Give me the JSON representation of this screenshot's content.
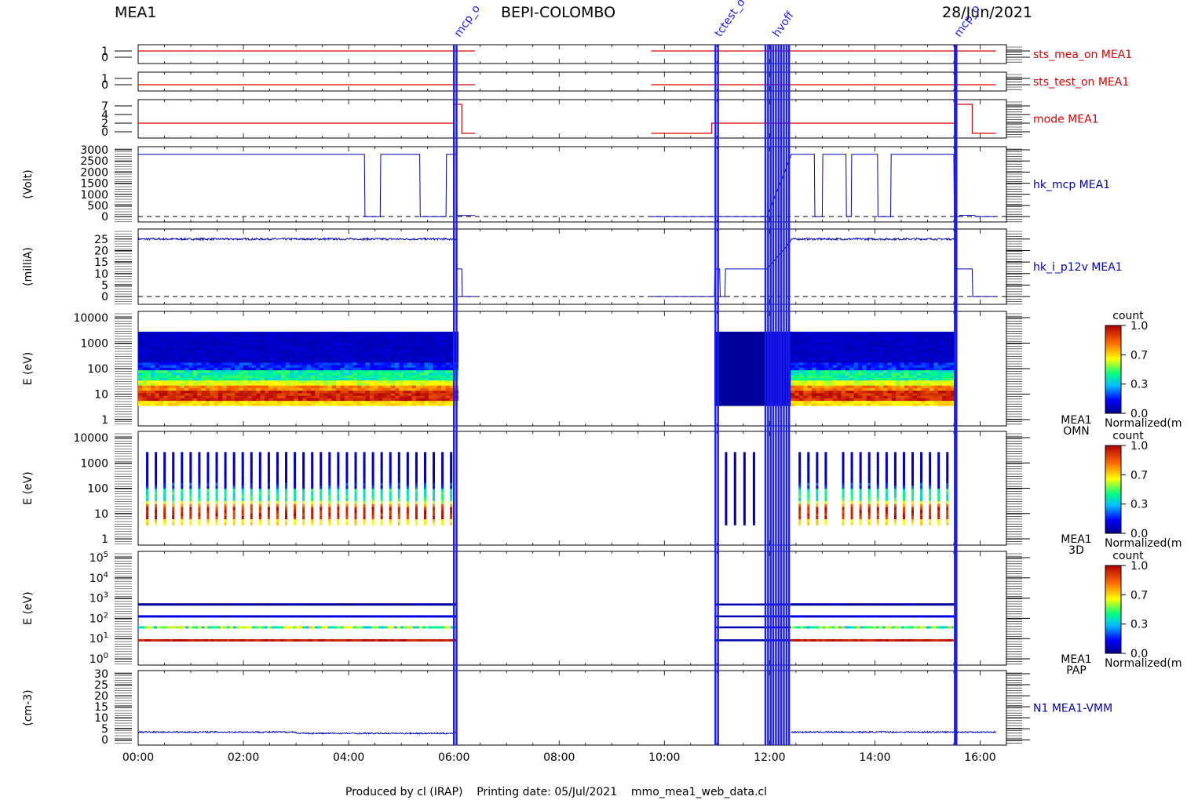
{
  "header": {
    "instrument": "MEA1",
    "mission": "BEPI-COLOMBO",
    "date": "28/Jun/2021"
  },
  "footer": {
    "text": "Produced by cl (IRAP)    Printing date: 05/Jul/2021    mmo_mea1_web_data.cl"
  },
  "colors": {
    "status_line": "#dd0000",
    "hk_line": "#0000bb",
    "event_line": "#1a1aff",
    "axis": "#000000"
  },
  "chart_data": {
    "type": "multi-panel time series",
    "time_axis": {
      "range_hours": [
        0,
        16.5
      ],
      "tick_labels": [
        "00:00",
        "02:00",
        "04:00",
        "06:00",
        "08:00",
        "10:00",
        "12:00",
        "14:00",
        "16:00"
      ]
    },
    "data_gaps_hours": [
      [
        6.4,
        9.75
      ]
    ],
    "event_markers": {
      "times_hours": [
        6.0,
        6.05,
        10.97,
        11.02,
        11.92,
        11.97,
        12.02,
        12.07,
        12.12,
        12.17,
        12.22,
        12.27,
        12.32,
        12.37,
        15.52,
        15.55
      ],
      "labels": [
        "mcp_o",
        "tctest_o",
        "hvoff",
        "mcp_o"
      ]
    },
    "panels": [
      {
        "id": "sts_mea_on",
        "label": "sts_mea_on MEA1",
        "ylabel": "",
        "y_ticks": [
          "1",
          "0"
        ],
        "color": "#dd0000",
        "segments": [
          {
            "t": [
              0,
              6.4
            ],
            "value": 1
          },
          {
            "t": [
              9.75,
              16.3
            ],
            "value": 1
          }
        ]
      },
      {
        "id": "sts_test_on",
        "label": "sts_test_on MEA1",
        "ylabel": "",
        "y_ticks": [
          "1",
          "0"
        ],
        "color": "#dd0000",
        "segments": [
          {
            "t": [
              0,
              6.4
            ],
            "value": 0
          },
          {
            "t": [
              9.75,
              16.3
            ],
            "value": 0
          }
        ]
      },
      {
        "id": "mode",
        "label": "mode MEA1",
        "ylabel": "",
        "y_ticks": [
          "7",
          "4",
          "2",
          "0"
        ],
        "color": "#dd0000",
        "segments": [
          {
            "t": [
              0,
              6.0
            ],
            "value": 2
          },
          {
            "t": [
              6.0,
              6.15
            ],
            "value": 7
          },
          {
            "t": [
              6.15,
              6.4
            ],
            "value": 0
          },
          {
            "t": [
              9.75,
              10.9
            ],
            "value": 0
          },
          {
            "t": [
              10.9,
              15.55
            ],
            "value": 2
          },
          {
            "t": [
              15.55,
              15.85
            ],
            "value": 7
          },
          {
            "t": [
              15.85,
              16.3
            ],
            "value": 0
          }
        ]
      },
      {
        "id": "hk_mcp",
        "label": "hk_mcp MEA1",
        "ylabel": "(Volt)",
        "y_ticks": [
          "3000",
          "2500",
          "2000",
          "1500",
          "1000",
          "500",
          "0"
        ],
        "ylim": [
          -100,
          3000
        ],
        "color": "#0000bb",
        "high_value": 2800,
        "low_value": 0,
        "dips_hours": [
          [
            4.3,
            4.6
          ],
          [
            5.35,
            5.85
          ],
          [
            12.85,
            13.0
          ],
          [
            13.45,
            13.55
          ],
          [
            14.05,
            14.3
          ],
          [
            15.5,
            15.6
          ]
        ],
        "reference_dashed": 0
      },
      {
        "id": "hk_i_p12v",
        "label": "hk_i_p12v MEA1",
        "ylabel": "(milliA)",
        "y_ticks": [
          "25",
          "20",
          "15",
          "10",
          "5",
          "0"
        ],
        "ylim": [
          -2,
          28
        ],
        "color": "#0000bb",
        "high_value": 25,
        "standby_value": 12,
        "reference_dashed": 0
      },
      {
        "id": "omn",
        "label": "MEA1 OMN",
        "ylabel": "E (eV)",
        "y_ticks": [
          "10000",
          "1000",
          "100",
          "10",
          "1"
        ],
        "y_scale": "log",
        "colorbar": {
          "title": "count",
          "ticks": [
            "1.0",
            "0.7",
            "0.3",
            "0.0"
          ],
          "caption": "Normalized(m"
        }
      },
      {
        "id": "3d",
        "label": "MEA1 3D",
        "ylabel": "E (eV)",
        "y_ticks": [
          "10000",
          "1000",
          "100",
          "10",
          "1"
        ],
        "y_scale": "log",
        "colorbar": {
          "title": "count",
          "ticks": [
            "1.0",
            "0.7",
            "0.3",
            "0.0"
          ],
          "caption": "Normalized(m"
        }
      },
      {
        "id": "pap",
        "label": "MEA1 PAP",
        "ylabel": "E (eV)",
        "y_ticks": [
          "10^5",
          "10^4",
          "10^3",
          "10^2",
          "10^1",
          "10^0"
        ],
        "y_scale": "log",
        "colorbar": {
          "title": "count",
          "ticks": [
            "1.0",
            "0.7",
            "0.3",
            "0.0"
          ],
          "caption": "Normalized(m"
        }
      },
      {
        "id": "n1",
        "label": "N1 MEA1-VMM",
        "ylabel": "(cm-3)",
        "y_ticks": [
          "30",
          "25",
          "20",
          "15",
          "10",
          "5",
          "0"
        ],
        "ylim": [
          -1,
          30
        ],
        "color": "#0000bb",
        "typical_value": 3.5
      }
    ]
  }
}
